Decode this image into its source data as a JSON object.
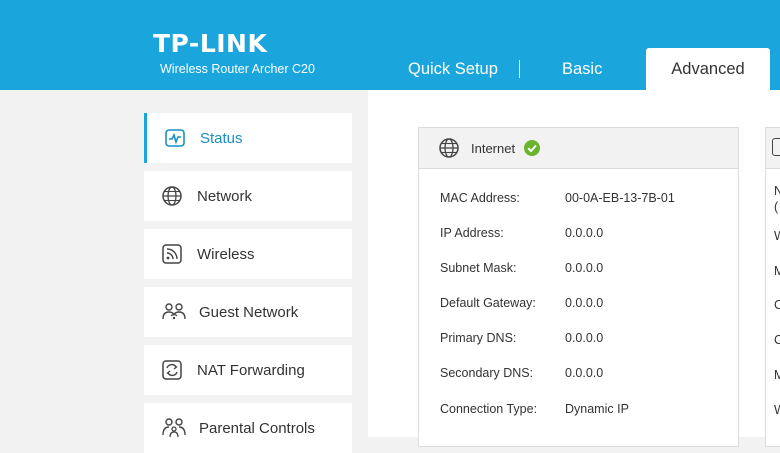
{
  "header": {
    "logo": "TP-LINK",
    "subtitle": "Wireless Router Archer C20",
    "tabs": [
      {
        "label": "Quick Setup"
      },
      {
        "label": "Basic"
      },
      {
        "label": "Advanced"
      }
    ],
    "accent_color": "#1aa6dd"
  },
  "sidebar": {
    "items": [
      {
        "label": "Status",
        "icon": "status-icon",
        "active": true
      },
      {
        "label": "Network",
        "icon": "globe-icon"
      },
      {
        "label": "Wireless",
        "icon": "wireless-icon"
      },
      {
        "label": "Guest Network",
        "icon": "guest-network-icon"
      },
      {
        "label": "NAT Forwarding",
        "icon": "nat-forwarding-icon"
      },
      {
        "label": "Parental Controls",
        "icon": "parental-controls-icon"
      }
    ]
  },
  "internet_panel": {
    "title": "Internet",
    "status_icon": "check-icon",
    "status_color": "#6ab42d",
    "rows": [
      {
        "label": "MAC Address:",
        "value": "00-0A-EB-13-7B-01"
      },
      {
        "label": "IP Address:",
        "value": "0.0.0.0"
      },
      {
        "label": "Subnet Mask:",
        "value": "0.0.0.0"
      },
      {
        "label": "Default Gateway:",
        "value": "0.0.0.0"
      },
      {
        "label": "Primary DNS:",
        "value": "0.0.0.0"
      },
      {
        "label": "Secondary DNS:",
        "value": "0.0.0.0"
      },
      {
        "label": "Connection Type:",
        "value": "Dynamic IP"
      }
    ]
  },
  "second_panel_fragments": [
    "N",
    "(",
    "W",
    "M",
    "C",
    "C",
    "M",
    "W"
  ]
}
